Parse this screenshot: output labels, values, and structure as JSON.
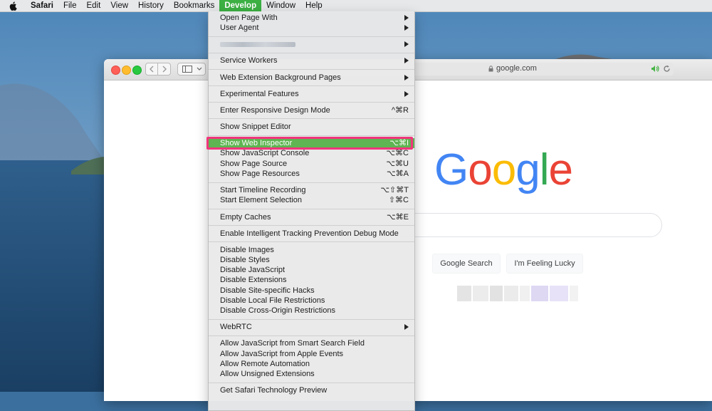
{
  "menubar": {
    "app": "Safari",
    "items": [
      "File",
      "Edit",
      "View",
      "History",
      "Bookmarks",
      "Develop",
      "Window",
      "Help"
    ],
    "active": "Develop"
  },
  "browser": {
    "url": "google.com"
  },
  "google": {
    "logo": [
      "G",
      "o",
      "o",
      "g",
      "l",
      "e"
    ],
    "logo_colors": [
      "#4285f4",
      "#ea4335",
      "#fbbc05",
      "#4285f4",
      "#34a853",
      "#ea4335"
    ],
    "search_button": "Google Search",
    "lucky_button": "I'm Feeling Lucky"
  },
  "develop_menu": {
    "open_page_with": "Open Page With",
    "user_agent": "User Agent",
    "service_workers": "Service Workers",
    "web_ext_bg": "Web Extension Background Pages",
    "experimental": "Experimental Features",
    "responsive": "Enter Responsive Design Mode",
    "responsive_sc": "^⌘R",
    "snippet": "Show Snippet Editor",
    "web_inspector": "Show Web Inspector",
    "web_inspector_sc": "⌥⌘I",
    "js_console": "Show JavaScript Console",
    "js_console_sc": "⌥⌘C",
    "page_source": "Show Page Source",
    "page_source_sc": "⌥⌘U",
    "page_resources": "Show Page Resources",
    "page_resources_sc": "⌥⌘A",
    "timeline": "Start Timeline Recording",
    "timeline_sc": "⌥⇧⌘T",
    "element_sel": "Start Element Selection",
    "element_sel_sc": "⇧⌘C",
    "empty_caches": "Empty Caches",
    "empty_caches_sc": "⌥⌘E",
    "itp": "Enable Intelligent Tracking Prevention Debug Mode",
    "disable_images": "Disable Images",
    "disable_styles": "Disable Styles",
    "disable_js": "Disable JavaScript",
    "disable_ext": "Disable Extensions",
    "disable_hacks": "Disable Site-specific Hacks",
    "disable_local": "Disable Local File Restrictions",
    "disable_cors": "Disable Cross-Origin Restrictions",
    "webrtc": "WebRTC",
    "allow_js_smart": "Allow JavaScript from Smart Search Field",
    "allow_js_apple": "Allow JavaScript from Apple Events",
    "allow_remote": "Allow Remote Automation",
    "allow_unsigned": "Allow Unsigned Extensions",
    "tech_preview": "Get Safari Technology Preview"
  }
}
